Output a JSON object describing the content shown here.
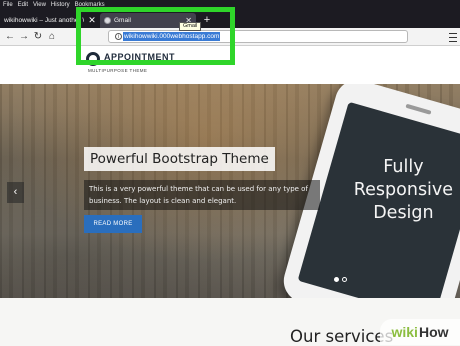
{
  "browser": {
    "menu_items": [
      "File",
      "Edit",
      "View",
      "History",
      "Bookmarks"
    ],
    "tabs": [
      {
        "title": "wikihowwiki – Just another W"
      },
      {
        "title": "Gmail"
      }
    ],
    "tab_tooltip": "Gmail",
    "url": "wikihowwiki.000webhostapp.com"
  },
  "site": {
    "brand_name": "APPOINTMENT",
    "brand_subtitle": "MULTIPURPOSE THEME",
    "hero": {
      "title": "Powerful Bootstrap Theme",
      "description": "This is a very powerful theme that can be used for any type of business. The layout is clean and elegant.",
      "button_label": "READ MORE",
      "phone_text": "Fully Responsive Design",
      "slides_total": 2,
      "slide_active": 1
    },
    "services_title": "Our services"
  },
  "watermark": {
    "part1": "wiki",
    "part2": "How"
  },
  "colors": {
    "highlight": "#2fd52a",
    "button": "#2a6ebd",
    "tab_bar": "#1c1b22"
  }
}
